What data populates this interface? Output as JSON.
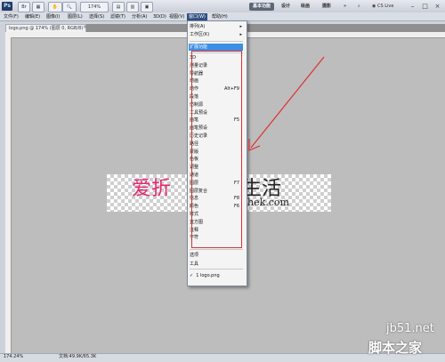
{
  "appbar": {
    "logo": "Ps",
    "zoom": "174%",
    "workspaces": [
      "基本功能",
      "设计",
      "绘画",
      "摄影"
    ],
    "more": "»",
    "cslive": "CS Live"
  },
  "menubar": [
    "文件(F)",
    "编辑(E)",
    "图像(I)",
    "图层(L)",
    "选择(S)",
    "滤镜(T)",
    "分析(A)",
    "3D(D)",
    "视图(V)",
    "窗口(W)",
    "帮助(H)"
  ],
  "document": {
    "tab_label": "logo.png @ 174% (图层 0, RGB/8)",
    "close": "×"
  },
  "logo": {
    "cn_left": "爱折",
    "cn_right": "生活",
    "en": "hek.com",
    "accent": "#e8266b"
  },
  "statusbar": {
    "zoom": "174.24%",
    "doc": "文档:49.9K/65.3K"
  },
  "dropdown": {
    "top_items": [
      {
        "label": "排列(A)",
        "submenu": true
      },
      {
        "label": "工作区(K)",
        "submenu": true
      }
    ],
    "extension": "扩展功能",
    "panels": [
      {
        "label": "3D",
        "shortcut": ""
      },
      {
        "label": "测量记录",
        "shortcut": ""
      },
      {
        "label": "导航器",
        "shortcut": ""
      },
      {
        "label": "动画",
        "shortcut": ""
      },
      {
        "label": "动作",
        "shortcut": "Alt+F9"
      },
      {
        "label": "段落",
        "shortcut": ""
      },
      {
        "label": "仿制源",
        "shortcut": ""
      },
      {
        "label": "工具预设",
        "shortcut": ""
      },
      {
        "label": "画笔",
        "shortcut": "F5"
      },
      {
        "label": "画笔预设",
        "shortcut": ""
      },
      {
        "label": "历史记录",
        "shortcut": ""
      },
      {
        "label": "路径",
        "shortcut": ""
      },
      {
        "label": "蒙版",
        "shortcut": ""
      },
      {
        "label": "色板",
        "shortcut": ""
      },
      {
        "label": "调整",
        "shortcut": ""
      },
      {
        "label": "通道",
        "shortcut": ""
      },
      {
        "label": "图层",
        "shortcut": "F7"
      },
      {
        "label": "图层复合",
        "shortcut": ""
      },
      {
        "label": "信息",
        "shortcut": "F8"
      },
      {
        "label": "颜色",
        "shortcut": "F6"
      },
      {
        "label": "样式",
        "shortcut": ""
      },
      {
        "label": "直方图",
        "shortcut": ""
      },
      {
        "label": "注释",
        "shortcut": ""
      },
      {
        "label": "字符",
        "shortcut": ""
      }
    ],
    "bottom_items": [
      "选项",
      "工具"
    ],
    "open_doc": {
      "check": "✓",
      "label": "1 logo.png"
    }
  },
  "watermark": {
    "site": "jb51.net",
    "brand": "脚本之家"
  },
  "colors": {
    "annotation_red": "#e03030",
    "menu_highlight": "#3d8ee6"
  }
}
